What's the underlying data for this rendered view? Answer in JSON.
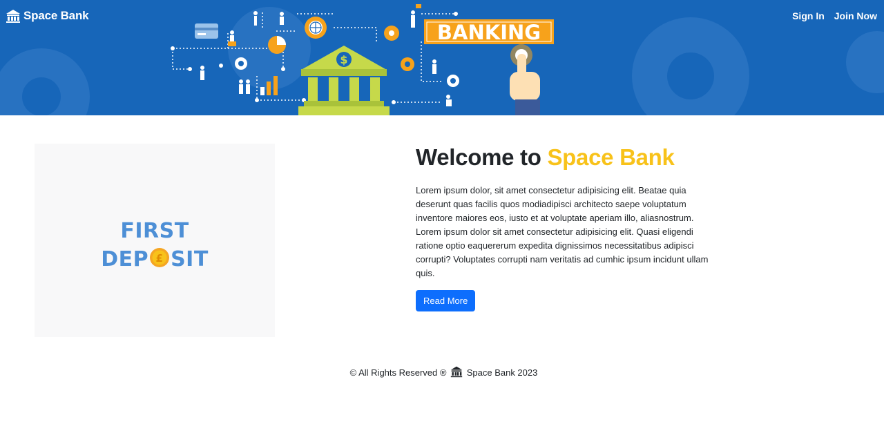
{
  "header": {
    "brand_name": "Space Bank",
    "nav": {
      "sign_in": "Sign In",
      "join_now": "Join Now"
    },
    "banner_word": "BANKING",
    "bank_symbol": "$"
  },
  "promo": {
    "line1": "FIRST",
    "line2_left": "DEP",
    "line2_right": "SIT",
    "coin_symbol": "£"
  },
  "main": {
    "welcome_prefix": "Welcome to ",
    "welcome_accent": "Space Bank",
    "intro": "Lorem ipsum dolor, sit amet consectetur adipisicing elit. Beatae quia deserunt quas facilis quos modiadipisci architecto saepe voluptatum inventore maiores eos, iusto et at voluptate aperiam illo, aliasnostrum. Lorem ipsum dolor sit amet consectetur adipisicing elit. Quasi eligendi ratione optio eaquererum expedita dignissimos necessitatibus adipisci corrupti? Voluptates corrupti nam veritatis ad cumhic ipsum incidunt ullam quis.",
    "read_more": "Read More"
  },
  "footer": {
    "left": "© All Rights Reserved ®",
    "right": "Space Bank 2023"
  },
  "colors": {
    "hero_blue": "#1766b9",
    "accent_yellow": "#f8c21a",
    "banner_orange": "#f7a21b",
    "button_blue": "#0d6efd",
    "promo_blue": "#4d8fd6"
  },
  "icons": [
    "bank-icon",
    "gear-icon",
    "credit-card-icon",
    "pie-chart-icon",
    "bar-chart-icon",
    "globe-icon",
    "trophy-icon",
    "hand-pointer-icon",
    "coin-icon"
  ]
}
